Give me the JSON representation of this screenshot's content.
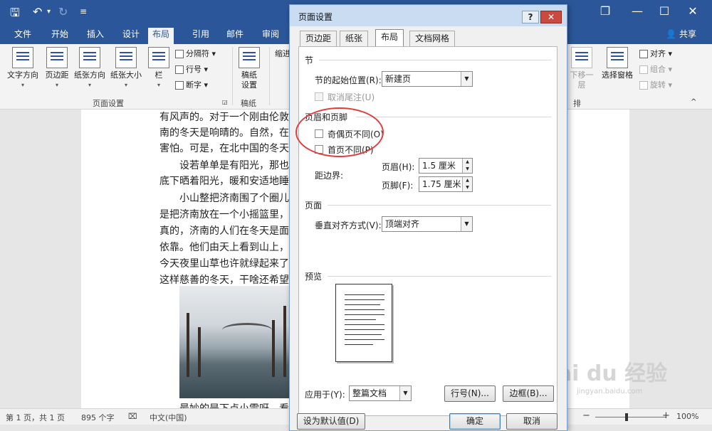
{
  "titlebar": {
    "icons": [
      "save-icon",
      "undo-icon",
      "redo-icon",
      "customize-icon"
    ],
    "window_controls": [
      "restore-icon",
      "minimize-icon",
      "maximize-icon",
      "close-icon"
    ]
  },
  "ribbon_tabs": [
    "文件",
    "开始",
    "插入",
    "设计",
    "布局",
    "引用",
    "邮件",
    "审阅"
  ],
  "active_tab": "布局",
  "share_label": "共享",
  "ribbon": {
    "page_setup": {
      "text_direction": "文字方向",
      "margins": "页边距",
      "orientation": "纸张方向",
      "size": "纸张大小",
      "columns": "栏",
      "breaks": "分隔符",
      "line_numbers": "行号",
      "hyphenation": "断字",
      "group_label": "页面设置"
    },
    "draft": {
      "draft_paper": "稿纸设置",
      "group_label": "稿纸"
    },
    "indent_label": "缩进",
    "arrange": {
      "send_back": "下移一层",
      "selection_pane": "选择窗格",
      "align": "对齐",
      "group": "组合",
      "rotate": "旋转",
      "group_label": "排列"
    }
  },
  "document": {
    "lines": [
      "有风声的。对于一个刚由伦敦回",
      "南的冬天是响晴的。自然，在热",
      "害怕。可是，在北中国的冬天，",
      "设若单单是有阳光，那也算",
      "底下晒着阳光，暖和安适地睡着",
      "小山整把济南围了个圈儿，",
      "是把济南放在一个小摇篮里，它",
      "真的，济南的人们在冬天是面上",
      "依靠。他们由天上看到山上，便",
      "今天夜里山草也许就绿起来了吧",
      "这样慈善的冬天，干啥还希望别"
    ],
    "bottom_line": "最妙的是下点小雪呀。看吧，"
  },
  "dialog": {
    "title": "页面设置",
    "help": "?",
    "close": "✕",
    "tabs": [
      "页边距",
      "纸张",
      "布局",
      "文档网格"
    ],
    "active_tab": "布局",
    "section": {
      "heading": "节",
      "start_label": "节的起始位置(R):",
      "start_value": "新建页",
      "suppress_endnotes": "取消尾注(U)"
    },
    "headers_footers": {
      "heading": "页眉和页脚",
      "odd_even": "奇偶页不同(O)",
      "first_page": "首页不同(P)",
      "from_edge": "距边界:",
      "header_label": "页眉(H):",
      "header_value": "1.5 厘米",
      "footer_label": "页脚(F):",
      "footer_value": "1.75 厘米"
    },
    "page": {
      "heading": "页面",
      "valign_label": "垂直对齐方式(V):",
      "valign_value": "顶端对齐"
    },
    "preview": {
      "heading": "预览"
    },
    "apply_to_label": "应用于(Y):",
    "apply_to_value": "整篇文档",
    "line_numbers_button": "行号(N)...",
    "borders_button": "边框(B)...",
    "set_default_button": "设为默认值(D)",
    "ok_button": "确定",
    "cancel_button": "取消"
  },
  "statusbar": {
    "page": "第 1 页，共 1 页",
    "words": "895 个字",
    "language": "中文(中国)",
    "zoom": "100%",
    "zoom_out": "−",
    "zoom_in": "+"
  },
  "watermark": {
    "brand": "Bai du 经验",
    "url": "jingyan.baidu.com"
  }
}
